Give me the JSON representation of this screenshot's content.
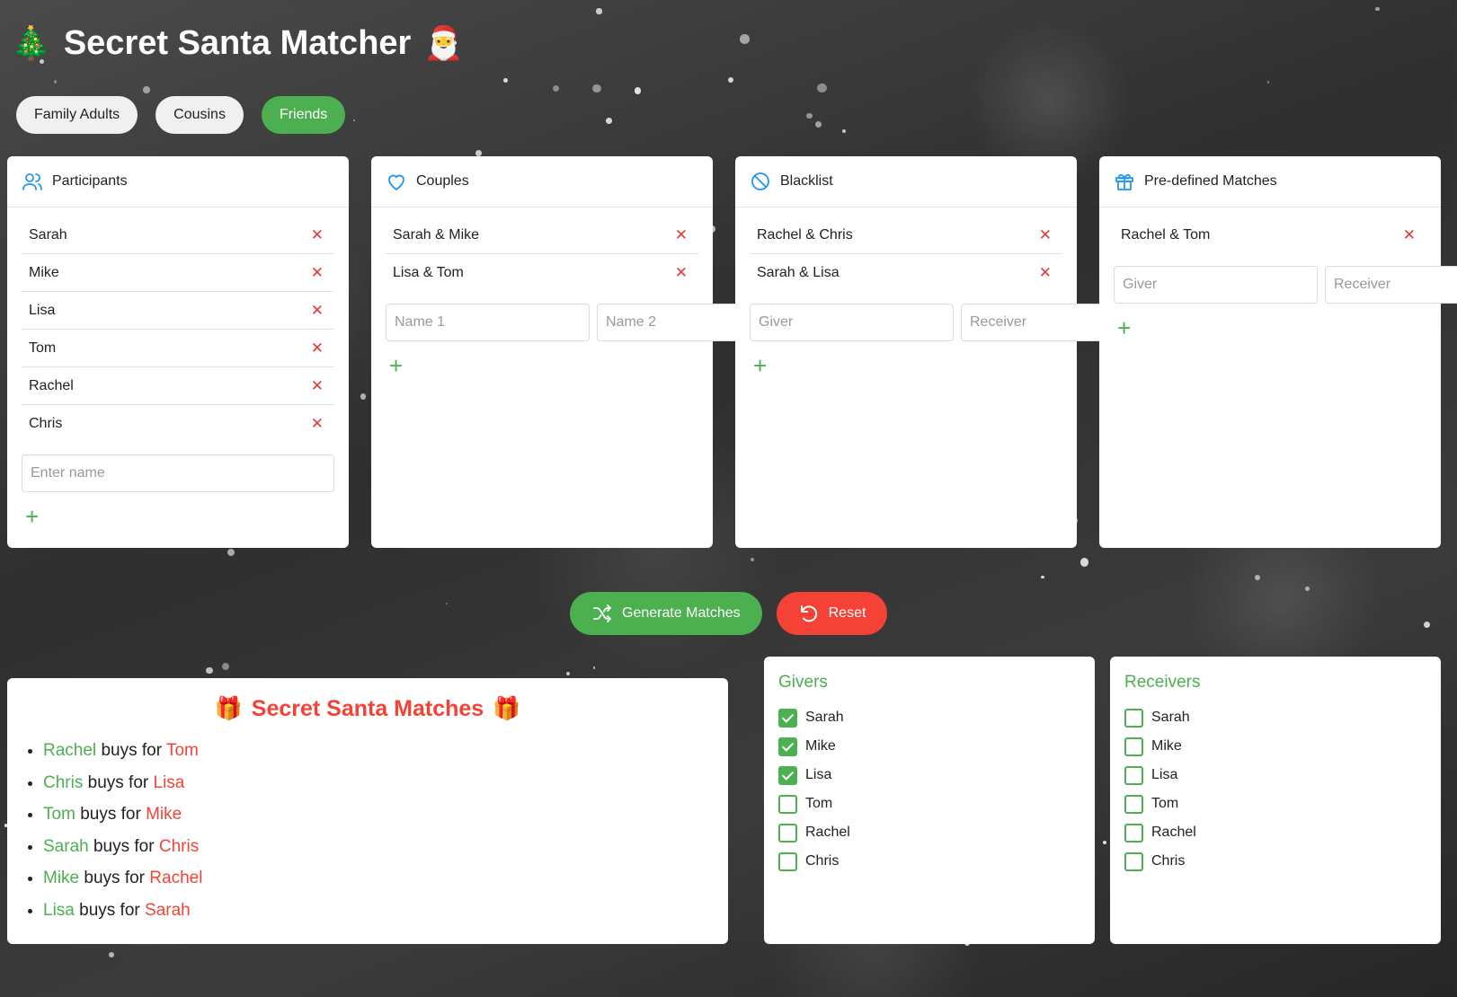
{
  "app": {
    "title": "Secret Santa Matcher",
    "title_left_emoji": "🎄",
    "title_right_emoji": "🎅"
  },
  "tabs": [
    {
      "label": "Family Adults",
      "active": false
    },
    {
      "label": "Cousins",
      "active": false
    },
    {
      "label": "Friends",
      "active": true
    }
  ],
  "participants": {
    "title": "Participants",
    "items": [
      "Sarah",
      "Mike",
      "Lisa",
      "Tom",
      "Rachel",
      "Chris"
    ],
    "input_placeholder": "Enter name"
  },
  "couples": {
    "title": "Couples",
    "items": [
      "Sarah & Mike",
      "Lisa & Tom"
    ],
    "placeholder_1": "Name 1",
    "placeholder_2": "Name 2"
  },
  "blacklist": {
    "title": "Blacklist",
    "items": [
      "Rachel & Chris",
      "Sarah & Lisa"
    ],
    "placeholder_1": "Giver",
    "placeholder_2": "Receiver"
  },
  "predefined": {
    "title": "Pre-defined Matches",
    "items": [
      "Rachel & Tom"
    ],
    "placeholder_1": "Giver",
    "placeholder_2": "Receiver"
  },
  "icons": {
    "remove": "close-icon",
    "add": "plus-icon"
  },
  "actions": {
    "generate_label": "Generate Matches",
    "reset_label": "Reset"
  },
  "results": {
    "title": "Secret Santa Matches",
    "title_emoji": "🎁",
    "connector": "buys for",
    "matches": [
      {
        "giver": "Rachel",
        "receiver": "Tom"
      },
      {
        "giver": "Chris",
        "receiver": "Lisa"
      },
      {
        "giver": "Tom",
        "receiver": "Mike"
      },
      {
        "giver": "Sarah",
        "receiver": "Chris"
      },
      {
        "giver": "Mike",
        "receiver": "Rachel"
      },
      {
        "giver": "Lisa",
        "receiver": "Sarah"
      }
    ]
  },
  "givers": {
    "title": "Givers",
    "items": [
      {
        "name": "Sarah",
        "checked": true
      },
      {
        "name": "Mike",
        "checked": true
      },
      {
        "name": "Lisa",
        "checked": true
      },
      {
        "name": "Tom",
        "checked": false
      },
      {
        "name": "Rachel",
        "checked": false
      },
      {
        "name": "Chris",
        "checked": false
      }
    ]
  },
  "receivers": {
    "title": "Receivers",
    "items": [
      {
        "name": "Sarah",
        "checked": false
      },
      {
        "name": "Mike",
        "checked": false
      },
      {
        "name": "Lisa",
        "checked": false
      },
      {
        "name": "Tom",
        "checked": false
      },
      {
        "name": "Rachel",
        "checked": false
      },
      {
        "name": "Chris",
        "checked": false
      }
    ]
  },
  "colors": {
    "accent_green": "#4caf50",
    "accent_red": "#f44336",
    "icon_blue": "#2196f3"
  }
}
